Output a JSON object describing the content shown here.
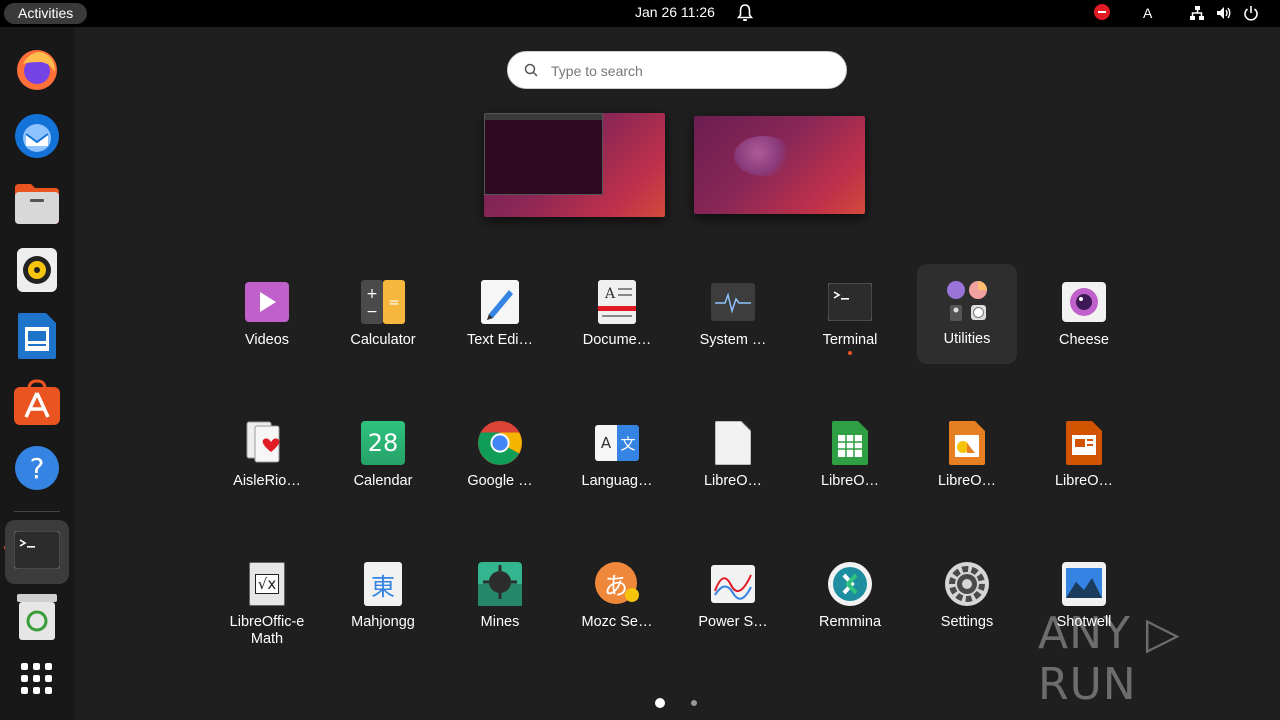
{
  "topbar": {
    "activities": "Activities",
    "clock": "Jan 26  11:26",
    "keyboard_layout": "A"
  },
  "dock": {
    "items": [
      {
        "name": "Firefox",
        "icon": "firefox-icon"
      },
      {
        "name": "Thunderbird",
        "icon": "thunderbird-icon"
      },
      {
        "name": "Files",
        "icon": "files-icon"
      },
      {
        "name": "Rhythmbox",
        "icon": "rhythmbox-icon"
      },
      {
        "name": "LibreOffice Writer",
        "icon": "writer-icon"
      },
      {
        "name": "Ubuntu Software",
        "icon": "software-icon"
      },
      {
        "name": "Help",
        "icon": "help-icon"
      },
      {
        "name": "Terminal",
        "icon": "terminal-icon"
      },
      {
        "name": "Trash",
        "icon": "trash-icon"
      },
      {
        "name": "Show Applications",
        "icon": "app-grid-icon"
      }
    ]
  },
  "search": {
    "placeholder": "Type to search"
  },
  "apps": [
    {
      "label": "Videos",
      "icon": "videos-icon"
    },
    {
      "label": "Calculator",
      "icon": "calculator-icon"
    },
    {
      "label": "Text Edi…",
      "icon": "text-editor-icon"
    },
    {
      "label": "Docume…",
      "icon": "document-viewer-icon"
    },
    {
      "label": "System …",
      "icon": "system-monitor-icon"
    },
    {
      "label": "Terminal",
      "icon": "terminal-icon"
    },
    {
      "label": "Utilities",
      "icon": "utilities-folder-icon"
    },
    {
      "label": "Cheese",
      "icon": "cheese-icon"
    },
    {
      "label": "AisleRio…",
      "icon": "aisleriot-icon"
    },
    {
      "label": "Calendar",
      "icon": "calendar-icon",
      "icon_text": "28"
    },
    {
      "label": "Google …",
      "icon": "chrome-icon"
    },
    {
      "label": "Languag…",
      "icon": "language-icon",
      "icon_text": "A 文"
    },
    {
      "label": "LibreO…",
      "icon": "libreoffice-icon"
    },
    {
      "label": "LibreO…",
      "icon": "libreoffice-calc-icon"
    },
    {
      "label": "LibreO…",
      "icon": "libreoffice-draw-icon"
    },
    {
      "label": "LibreO…",
      "icon": "libreoffice-impress-icon"
    },
    {
      "label": "LibreOffic-e Math",
      "icon": "libreoffice-math-icon",
      "icon_text": "√x"
    },
    {
      "label": "Mahjongg",
      "icon": "mahjongg-icon",
      "icon_text": "東"
    },
    {
      "label": "Mines",
      "icon": "mines-icon"
    },
    {
      "label": "Mozc Se…",
      "icon": "mozc-icon",
      "icon_text": "あ"
    },
    {
      "label": "Power S…",
      "icon": "power-statistics-icon"
    },
    {
      "label": "Remmina",
      "icon": "remmina-icon"
    },
    {
      "label": "Settings",
      "icon": "settings-icon"
    },
    {
      "label": "Shotwell",
      "icon": "shotwell-icon"
    }
  ],
  "watermark": "ANY ▷ RUN",
  "colors": {
    "accent": "#e95420",
    "background": "#1f1f1f",
    "topbar": "#000000"
  }
}
